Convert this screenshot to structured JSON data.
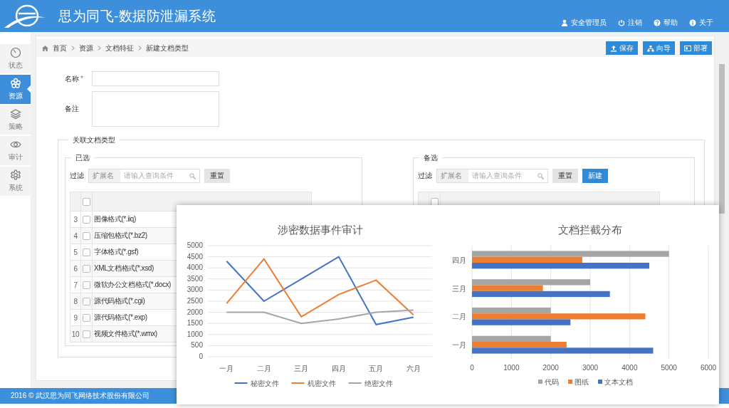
{
  "header": {
    "title": "思为同飞-数据防泄漏系统",
    "links": [
      {
        "label": "安全管理员"
      },
      {
        "label": "注销"
      },
      {
        "label": "帮助"
      },
      {
        "label": "关于"
      }
    ]
  },
  "sidebar": {
    "items": [
      {
        "label": "状态",
        "selected": false
      },
      {
        "label": "资源",
        "selected": true
      },
      {
        "label": "策略",
        "selected": false
      },
      {
        "label": "审计",
        "selected": false
      },
      {
        "label": "系统",
        "selected": false
      }
    ]
  },
  "breadcrumb": [
    "首页",
    "资源",
    "文档特征",
    "新建文档类型"
  ],
  "toolbar": [
    "保存",
    "向导",
    "部署"
  ],
  "form": {
    "fields": [
      {
        "kind": "input",
        "label": "名称",
        "marker": "*"
      },
      {
        "kind": "textarea",
        "label": "备注"
      }
    ]
  },
  "associated": {
    "legend": "关联文档类型",
    "panels": [
      {
        "legend": "已选",
        "filter_label": "过滤",
        "filter_field": "扩展名",
        "placeholder": "请输入查询条件",
        "buttons": [
          {
            "kind": "default",
            "label": "重置"
          }
        ],
        "header_checkbox": {
          "checked": false
        },
        "rows": [
          {
            "index": "3",
            "checked": false,
            "name": "图像格式(*.iiq)"
          },
          {
            "index": "4",
            "checked": false,
            "name": "压缩包格式(*.bz2)"
          },
          {
            "index": "5",
            "checked": false,
            "name": "字体格式(*.gsf)"
          },
          {
            "index": "6",
            "checked": false,
            "name": "XML文档格式(*.xsd)"
          },
          {
            "index": "7",
            "checked": false,
            "name": "微软办公文档格式(*.docx)"
          },
          {
            "index": "8",
            "checked": false,
            "name": "源代码格式(*.cgi)"
          },
          {
            "index": "9",
            "checked": false,
            "name": "源代码格式(*.exp)"
          },
          {
            "index": "10",
            "checked": false,
            "name": "视频文件格式(*.wmx)"
          }
        ]
      },
      {
        "legend": "备选",
        "filter_label": "过滤",
        "filter_field": "扩展名",
        "placeholder": "请输入查询条件",
        "buttons": [
          {
            "kind": "default",
            "label": "重置"
          },
          {
            "kind": "primary",
            "label": "新建"
          }
        ],
        "header_checkbox": {
          "checked": false
        }
      }
    ]
  },
  "footer": "2016 © 武汉思为同飞网络技术股份有限公司",
  "charts": [
    {
      "chart_data": {
        "type": "line",
        "title": "涉密数据事件审计",
        "categories": [
          "一月",
          "二月",
          "三月",
          "四月",
          "五月",
          "六月"
        ],
        "series": [
          {
            "name": "秘密文件",
            "color": "#4472c4",
            "values": [
              4300,
              2500,
              3500,
              4500,
              1450,
              1780
            ]
          },
          {
            "name": "机密文件",
            "color": "#ed7d31",
            "values": [
              2400,
              4400,
              1800,
              2800,
              3450,
              1880
            ]
          },
          {
            "name": "绝密文件",
            "color": "#a5a5a5",
            "values": [
              2000,
              2000,
              1500,
              1700,
              2000,
              2100
            ]
          }
        ],
        "ylim": [
          0,
          5000
        ],
        "yticks": [
          0,
          500,
          1000,
          1500,
          2000,
          2500,
          3000,
          3500,
          4000,
          4500,
          5000
        ],
        "grid": true,
        "legend": true
      }
    },
    {
      "chart_data": {
        "type": "bar",
        "orientation": "horizontal",
        "title": "文档拦截分布",
        "categories": [
          "四月",
          "三月",
          "二月",
          "一月"
        ],
        "series": [
          {
            "name": "代码",
            "color": "#a5a5a5",
            "values": [
              5000,
              3000,
              2000,
              2000
            ]
          },
          {
            "name": "图纸",
            "color": "#ed7d31",
            "values": [
              2800,
              1800,
              4400,
              2400
            ]
          },
          {
            "name": "文本文档",
            "color": "#4472c4",
            "values": [
              4500,
              3500,
              2500,
              4600
            ]
          }
        ],
        "xlim": [
          0,
          6000
        ],
        "xticks": [
          0,
          1000,
          2000,
          3000,
          4000,
          5000,
          6000
        ],
        "grid": true,
        "legend": true
      }
    }
  ]
}
